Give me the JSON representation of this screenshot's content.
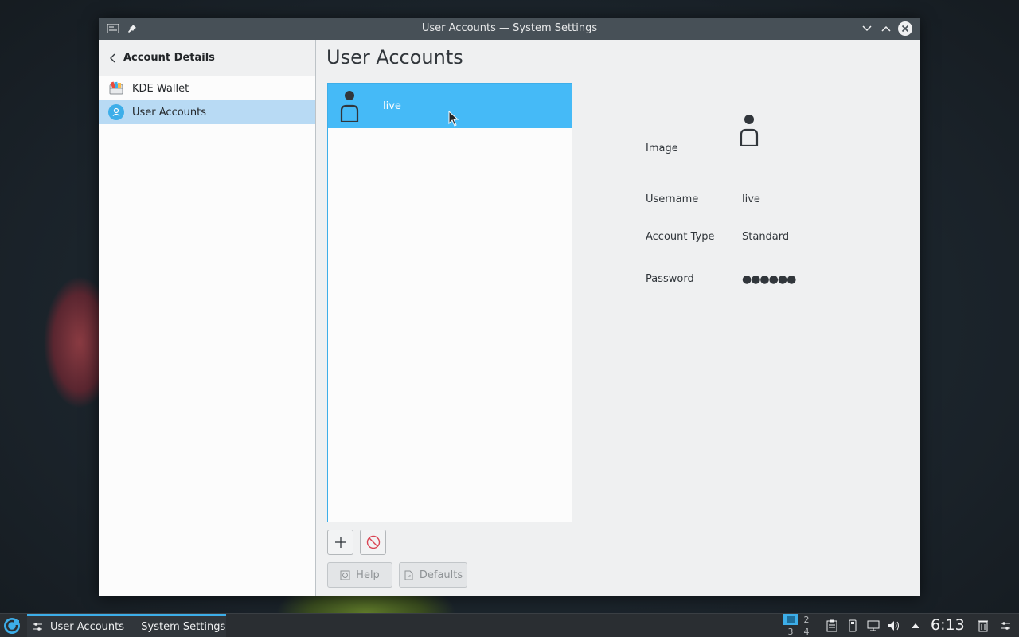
{
  "window": {
    "title": "User Accounts — System Settings"
  },
  "sidebar": {
    "header": "Account Details",
    "items": [
      {
        "label": "KDE Wallet",
        "icon": "wallet-icon",
        "selected": false
      },
      {
        "label": "User Accounts",
        "icon": "user-accounts-icon",
        "selected": true
      }
    ]
  },
  "main": {
    "title": "User Accounts",
    "users": [
      {
        "name": "live",
        "selected": true
      }
    ],
    "details": {
      "image_label": "Image",
      "username_label": "Username",
      "username_value": "live",
      "account_type_label": "Account Type",
      "account_type_value": "Standard",
      "password_label": "Password",
      "password_value": "●●●●●●"
    },
    "buttons": {
      "help": "Help",
      "defaults": "Defaults"
    }
  },
  "taskbar": {
    "task_label": "User Accounts  — System Settings",
    "pager": [
      "1",
      "2",
      "3",
      "4"
    ],
    "active_desktop": "1",
    "clock": "6:13"
  },
  "colors": {
    "accent": "#3daee9",
    "selected_row": "#45baf7",
    "sidebar_selected": "#b8daf4",
    "titlebar": "#475057"
  }
}
